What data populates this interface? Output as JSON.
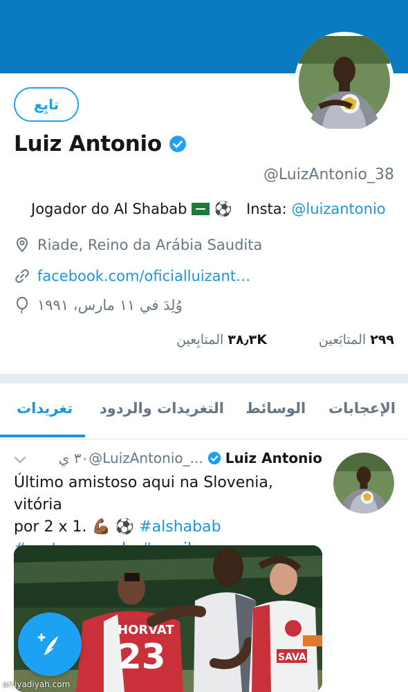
{
  "profile": {
    "follow_label": "تابِع",
    "name": "Luiz Antonio",
    "handle": "@LuizAntonio_38",
    "bio_text": "Jogador do Al Shabab",
    "bio_insta_label": "Insta:",
    "bio_insta_link": "@luizantonio",
    "location": "Riade, Reino da Arábia Saudita",
    "website": "facebook.com/oficialluizant…",
    "birth": "وُلِدَ في ١١ مارس، ١٩٩١"
  },
  "stats": {
    "following_count": "٢٩٩",
    "following_label": "المتابَعين",
    "followers_count": "٣٨٫٣K",
    "followers_label": "المتابِعين"
  },
  "tabs": [
    {
      "label": "تغريدات",
      "active": true
    },
    {
      "label": "التغريدات والردود",
      "active": false
    },
    {
      "label": "الوسائط",
      "active": false
    },
    {
      "label": "الإعجابات",
      "active": false
    }
  ],
  "tweet": {
    "author_name": "Luiz Antonio",
    "author_handle": "@LuizAntonio_...",
    "time": "٣٠ ي",
    "text_line1": "Último amistoso aqui na Slovenia, vitória",
    "text_line2": "por 2 x 1. 💪🏾 ⚽",
    "hashtag1": "#alshabab",
    "hashtag2": "#pretemporada",
    "hashtag3": "#maribor"
  },
  "media": {
    "jersey_left_name": "HORVAT",
    "jersey_left_number": "23",
    "jersey_right_sponsor": "SAVA"
  },
  "watermark": "arriyadiyah.com",
  "colors": {
    "banner": "#0a7bbf",
    "accent": "#1da1f2",
    "link": "#1b95e0",
    "secondary_text": "#657786"
  },
  "icons": [
    "verified-badge-icon",
    "location-pin-icon",
    "link-icon",
    "birthday-balloon-icon",
    "chevron-down-icon",
    "compose-tweet-icon"
  ]
}
